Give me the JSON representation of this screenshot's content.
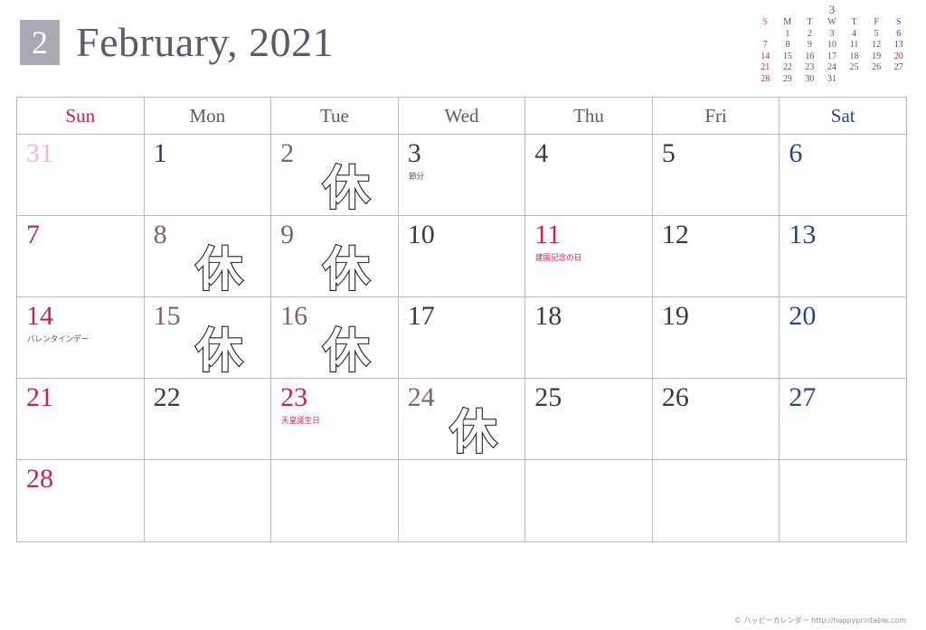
{
  "header": {
    "month_number": "2",
    "title": "February, 2021"
  },
  "mini_calendar": {
    "month_label": "3",
    "weekday_initials": [
      "S",
      "M",
      "T",
      "W",
      "T",
      "F",
      "S"
    ],
    "weeks": [
      [
        "",
        "1",
        "2",
        "3",
        "4",
        "5",
        "6"
      ],
      [
        "7",
        "8",
        "9",
        "10",
        "11",
        "12",
        "13"
      ],
      [
        "14",
        "15",
        "16",
        "17",
        "18",
        "19",
        "20"
      ],
      [
        "21",
        "22",
        "23",
        "24",
        "25",
        "26",
        "27"
      ],
      [
        "28",
        "29",
        "30",
        "31",
        "",
        "",
        ""
      ]
    ],
    "holiday_days": [
      "20"
    ]
  },
  "weekday_headers": [
    "Sun",
    "Mon",
    "Tue",
    "Wed",
    "Thu",
    "Fri",
    "Sat"
  ],
  "rest_mark_label": "休",
  "weeks": [
    [
      {
        "day": "31",
        "kind": "other"
      },
      {
        "day": "1",
        "kind": "weekday"
      },
      {
        "day": "2",
        "kind": "rest"
      },
      {
        "day": "3",
        "kind": "weekday",
        "note": "節分"
      },
      {
        "day": "4",
        "kind": "weekday"
      },
      {
        "day": "5",
        "kind": "weekday"
      },
      {
        "day": "6",
        "kind": "sat"
      }
    ],
    [
      {
        "day": "7",
        "kind": "sun"
      },
      {
        "day": "8",
        "kind": "rest"
      },
      {
        "day": "9",
        "kind": "rest"
      },
      {
        "day": "10",
        "kind": "weekday"
      },
      {
        "day": "11",
        "kind": "holiday",
        "note": "建国記念の日"
      },
      {
        "day": "12",
        "kind": "weekday"
      },
      {
        "day": "13",
        "kind": "sat"
      }
    ],
    [
      {
        "day": "14",
        "kind": "sun",
        "note": "バレンタインデー"
      },
      {
        "day": "15",
        "kind": "rest"
      },
      {
        "day": "16",
        "kind": "rest"
      },
      {
        "day": "17",
        "kind": "weekday"
      },
      {
        "day": "18",
        "kind": "weekday"
      },
      {
        "day": "19",
        "kind": "weekday"
      },
      {
        "day": "20",
        "kind": "sat"
      }
    ],
    [
      {
        "day": "21",
        "kind": "sun"
      },
      {
        "day": "22",
        "kind": "weekday"
      },
      {
        "day": "23",
        "kind": "holiday",
        "note": "天皇誕生日"
      },
      {
        "day": "24",
        "kind": "rest"
      },
      {
        "day": "25",
        "kind": "weekday"
      },
      {
        "day": "26",
        "kind": "weekday"
      },
      {
        "day": "27",
        "kind": "sat"
      }
    ],
    [
      {
        "day": "28",
        "kind": "sun"
      },
      {
        "day": "",
        "kind": "empty"
      },
      {
        "day": "",
        "kind": "empty"
      },
      {
        "day": "",
        "kind": "empty"
      },
      {
        "day": "",
        "kind": "empty"
      },
      {
        "day": "",
        "kind": "empty"
      },
      {
        "day": "",
        "kind": "empty"
      }
    ]
  ],
  "footer": {
    "credit": "© ハッピーカレンダー   http://happyprintable.com"
  },
  "colors": {
    "sunday": "#cc1f53",
    "saturday": "#26478d",
    "rest_background": "#fbd7d8",
    "badge_background": "#a9a9b3",
    "title_text": "#5b5b6b",
    "grid_border": "#b9b9bf"
  }
}
